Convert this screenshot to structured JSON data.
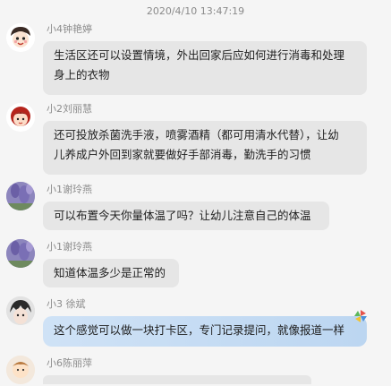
{
  "chat": {
    "timestamp": "2020/4/10 13:47:19",
    "messages": [
      {
        "sender": "小4钟艳婷",
        "lines": [
          "生活区还可以设置情境，外出回家后应如何进行消毒和处理",
          "身上的衣物"
        ],
        "avatar_icon": "cartoon-face-avatar"
      },
      {
        "sender": "小2刘丽慧",
        "lines": [
          "还可投放杀菌洗手液，喷雾酒精（都可用清水代替），让幼",
          "儿养成户外回到家就要做好手部消毒，勤洗手的习惯"
        ],
        "avatar_icon": "cartoon-girl-avatar"
      },
      {
        "sender": "小1谢玲燕",
        "lines": [
          "可以布置今天你量体温了吗？让幼儿注意自己的体温"
        ],
        "avatar_icon": "lavender-avatar"
      },
      {
        "sender": "小1谢玲燕",
        "lines": [
          "知道体温多少是正常的"
        ],
        "avatar_icon": "lavender-avatar"
      },
      {
        "sender": "小3  徐斌",
        "lines": [
          "这个感觉可以做一块打卡区，专门记录提问，就像报道一样"
        ],
        "avatar_icon": "anime-avatar"
      },
      {
        "sender": "小6陈丽萍",
        "lines": [],
        "avatar_icon": "cartoon-child-avatar"
      }
    ]
  },
  "colors": {
    "background": "#f5f5f5",
    "bubble": "#e6e6e6",
    "highlight_bubble": "#c4dbf3",
    "name_text": "#8c8c8c",
    "message_text": "#1e1e1e"
  }
}
